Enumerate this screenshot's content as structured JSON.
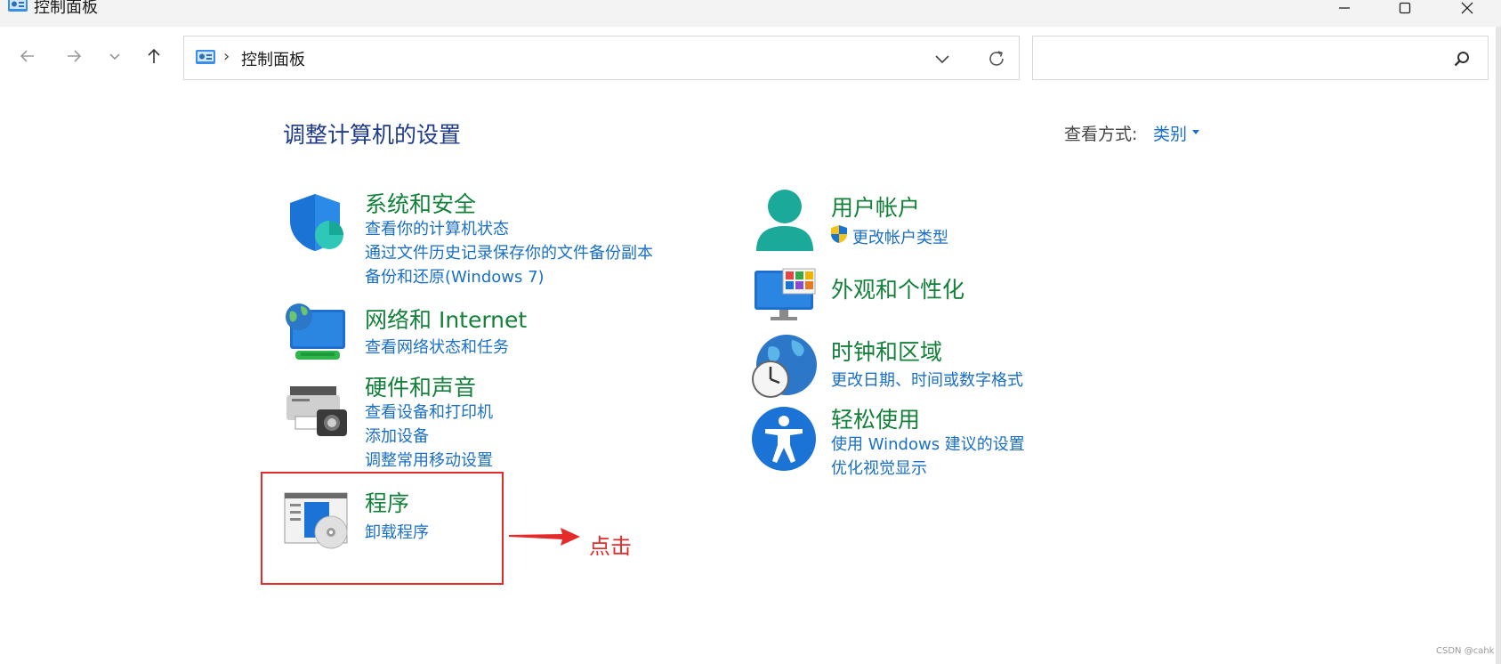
{
  "window": {
    "title": "控制面板"
  },
  "address": {
    "separator": "›",
    "location": "控制面板"
  },
  "search": {
    "placeholder": ""
  },
  "header": {
    "title": "调整计算机的设置",
    "view_by_label": "查看方式:",
    "view_by_value": "类别"
  },
  "categories": {
    "system_security": {
      "title": "系统和安全",
      "links": [
        "查看你的计算机状态",
        "通过文件历史记录保存你的文件备份副本",
        "备份和还原(Windows 7)"
      ]
    },
    "network": {
      "title": "网络和 Internet",
      "links": [
        "查看网络状态和任务"
      ]
    },
    "hardware": {
      "title": "硬件和声音",
      "links": [
        "查看设备和打印机",
        "添加设备",
        "调整常用移动设置"
      ]
    },
    "programs": {
      "title": "程序",
      "links": [
        "卸载程序"
      ]
    },
    "user_accounts": {
      "title": "用户帐户",
      "links": [
        "更改帐户类型"
      ]
    },
    "appearance": {
      "title": "外观和个性化",
      "links": []
    },
    "clock_region": {
      "title": "时钟和区域",
      "links": [
        "更改日期、时间或数字格式"
      ]
    },
    "ease_access": {
      "title": "轻松使用",
      "links": [
        "使用 Windows 建议的设置",
        "优化视觉显示"
      ]
    }
  },
  "annotation": {
    "text": "点击",
    "color": "#e52a2a"
  },
  "watermark": "CSDN @cahk",
  "colors": {
    "category_title": "#14813a",
    "link": "#1a6fc7",
    "page_title": "#1e3a8a"
  }
}
